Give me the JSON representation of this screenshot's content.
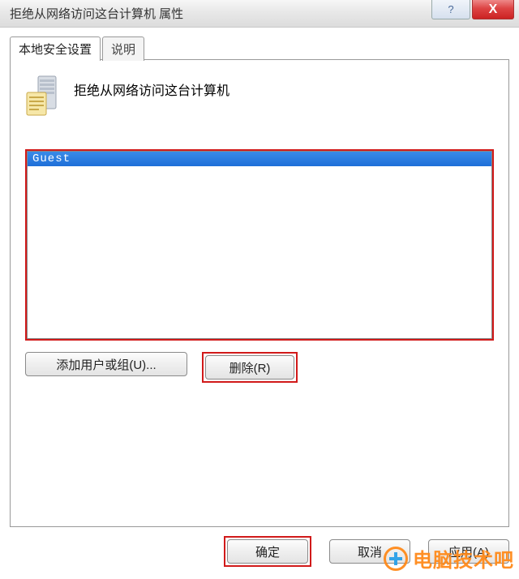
{
  "window": {
    "title": "拒绝从网络访问这台计算机 属性",
    "help_glyph": "?",
    "close_glyph": "X"
  },
  "tabs": {
    "active": "本地安全设置",
    "inactive": "说明"
  },
  "policy": {
    "title": "拒绝从网络访问这台计算机"
  },
  "list": {
    "items": [
      {
        "label": "Guest",
        "selected": true
      }
    ]
  },
  "buttons": {
    "add": "添加用户或组(U)...",
    "remove": "删除(R)",
    "ok": "确定",
    "cancel": "取消",
    "apply": "应用(A)"
  },
  "watermark": {
    "text": "电脑技术吧"
  }
}
